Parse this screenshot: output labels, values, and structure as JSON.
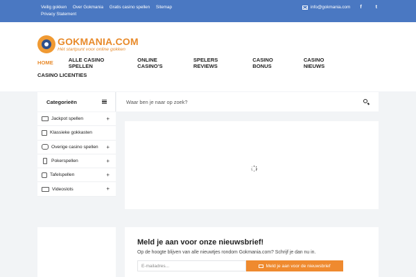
{
  "topbar": {
    "links": [
      "Veilig gokken",
      "Over Gokmania",
      "Gratis casino spellen",
      "Sitemap",
      "Privacy Statement"
    ],
    "email": "info@gokmania.com",
    "facebook": "f",
    "twitter": "t"
  },
  "logo": {
    "name": "GOKMANIA.COM",
    "tagline": "Hét startpunt voor online gokken"
  },
  "nav": {
    "items": [
      "HOME",
      "ALLE CASINO SPELLEN",
      "ONLINE CASINO'S",
      "SPELERS REVIEWS",
      "CASINO BONUS",
      "CASINO NIEUWS",
      "CASINO LICENTIES"
    ]
  },
  "sidebar": {
    "title": "Categorieën",
    "items": [
      {
        "label": "Jackpot spellen",
        "icon": "jackpot-icon",
        "plus": "+"
      },
      {
        "label": "Klassieke gokkasten",
        "icon": "slot-machine-icon",
        "plus": ""
      },
      {
        "label": "Overige casino spellen",
        "icon": "game-icon",
        "plus": "+"
      },
      {
        "label": "Pokerspellen",
        "icon": "card-icon",
        "plus": "+"
      },
      {
        "label": "Tafelspellen",
        "icon": "dice-icon",
        "plus": "+"
      },
      {
        "label": "Videoslots",
        "icon": "video-slot-icon",
        "plus": "+"
      }
    ]
  },
  "search": {
    "placeholder": "Waar ben je naar op zoek?"
  },
  "newsletter": {
    "title": "Meld je aan voor onze nieuwsbrief!",
    "text": "Op de hoogte blijven van alle nieuwtjes rondom Gokmania.com? Schrijf je dan nu in.",
    "email_placeholder": "E-mailadres...",
    "button_label": "Meld je aan voor de nieuwsbrief"
  },
  "colors": {
    "topbar": "#4a78c2",
    "accent": "#e88a2a",
    "button": "#ef8a2f"
  }
}
